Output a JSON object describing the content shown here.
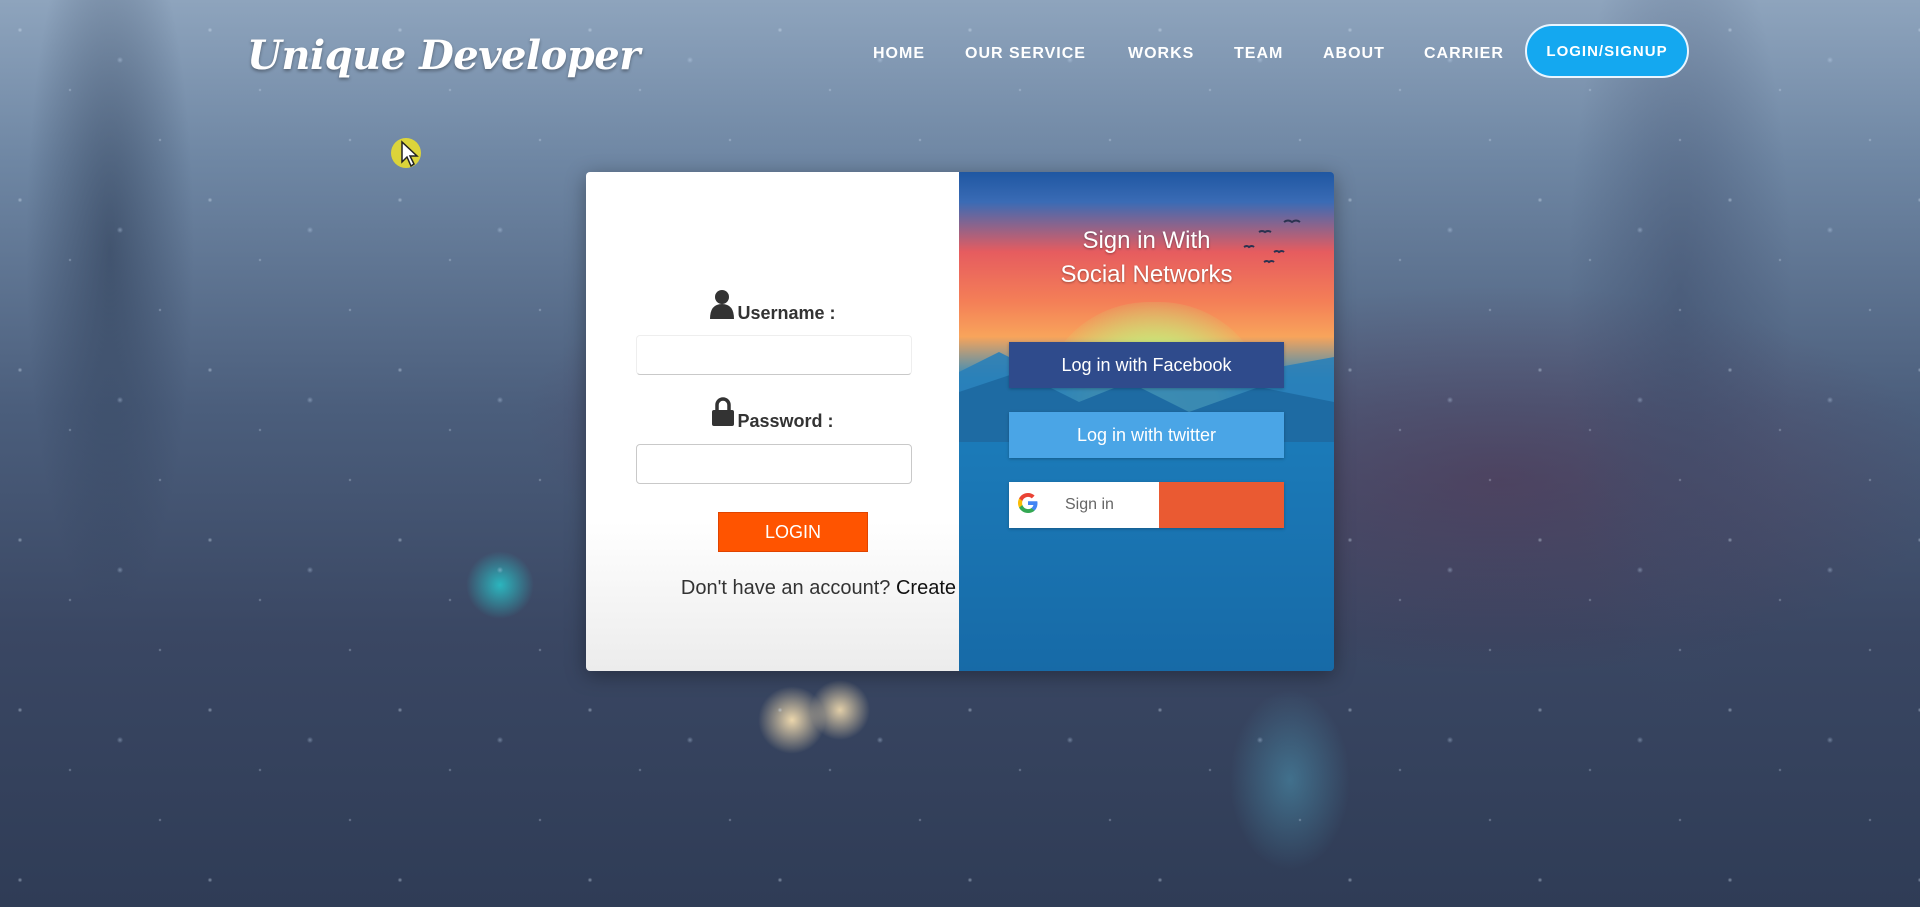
{
  "brand": {
    "logo_text": "Unique Developer"
  },
  "nav": {
    "items": [
      "HOME",
      "OUR SERVICE",
      "WORKS",
      "TEAM",
      "ABOUT",
      "CARRIER"
    ],
    "login_button": "LOGIN/SIGNUP"
  },
  "login_form": {
    "username_label": "Username :",
    "password_label": "Password :",
    "username_value": "",
    "password_value": "",
    "submit_label": "LOGIN",
    "signup_prompt": "Don't have an account?",
    "signup_link": "Create"
  },
  "social": {
    "title_line1": "Sign in With",
    "title_line2": "Social Networks",
    "facebook_label": "Log in with Facebook",
    "twitter_label": "Log in with twitter",
    "google_label": "Sign in"
  },
  "colors": {
    "accent_orange": "#ff5400",
    "nav_login_blue": "#14a8f0",
    "facebook_blue": "#2f4b8c",
    "twitter_blue": "#4aa5e6",
    "google_red": "#ea5a32"
  },
  "icons": [
    "user-icon",
    "lock-icon",
    "google-icon",
    "cursor-icon"
  ]
}
